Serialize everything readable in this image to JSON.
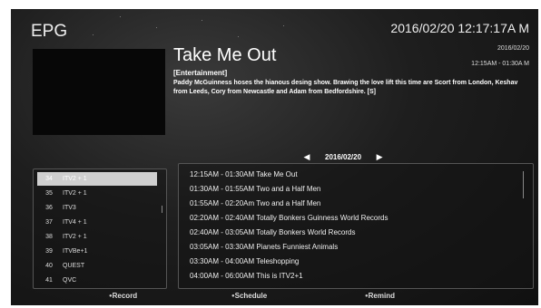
{
  "header": {
    "title": "EPG",
    "datetime": "2016/02/20 12:17:17A  M"
  },
  "program": {
    "title": "Take Me Out",
    "date": "2016/02/20",
    "time": "12:15AM - 01:30A  M",
    "category": "[Entertainment]",
    "description": "Paddy McGuinness hoses the hianous desing show.  Brawing the love lift this time are Scort from London, Keshav from Leeds, Cory from Newcastle and Adam from Bedfordshire. [S]"
  },
  "date_nav": {
    "prev_icon": "triangle-left-icon",
    "date": "2016/02/20",
    "next_icon": "triangle-right-icon"
  },
  "channels": [
    {
      "num": "34",
      "name": "ITV2 + 1",
      "selected": true
    },
    {
      "num": "35",
      "name": "ITV2 + 1",
      "selected": false
    },
    {
      "num": "36",
      "name": "ITV3",
      "selected": false
    },
    {
      "num": "37",
      "name": "ITV4 + 1",
      "selected": false
    },
    {
      "num": "38",
      "name": "ITV2 + 1",
      "selected": false
    },
    {
      "num": "39",
      "name": "ITVBe+1",
      "selected": false
    },
    {
      "num": "40",
      "name": "QUEST",
      "selected": false
    },
    {
      "num": "41",
      "name": "QVC",
      "selected": false
    }
  ],
  "schedule": [
    "12:15AM - 01:30AM Take Me Out",
    "01:30AM - 01:55AM Two and a Half Men",
    "01:55AM - 02:20Am Two and a Half Men",
    "02:20AM - 02:40AM Totally Bonkers Guinness World Records",
    "02:40AM - 03:05AM Totally Bonkers World Records",
    "03:05AM - 03:30AM Pianets Funniest Animals",
    "03:30AM - 04:00AM Teleshopping",
    "04:00AM - 06:00AM This is ITV2+1"
  ],
  "buttons": {
    "record": "Record",
    "schedule": "Schedule",
    "remind": "Remind"
  },
  "colors": {
    "background": "#1e1e1e",
    "selected_row": "#cfcfcf",
    "panel_border": "#555555"
  }
}
